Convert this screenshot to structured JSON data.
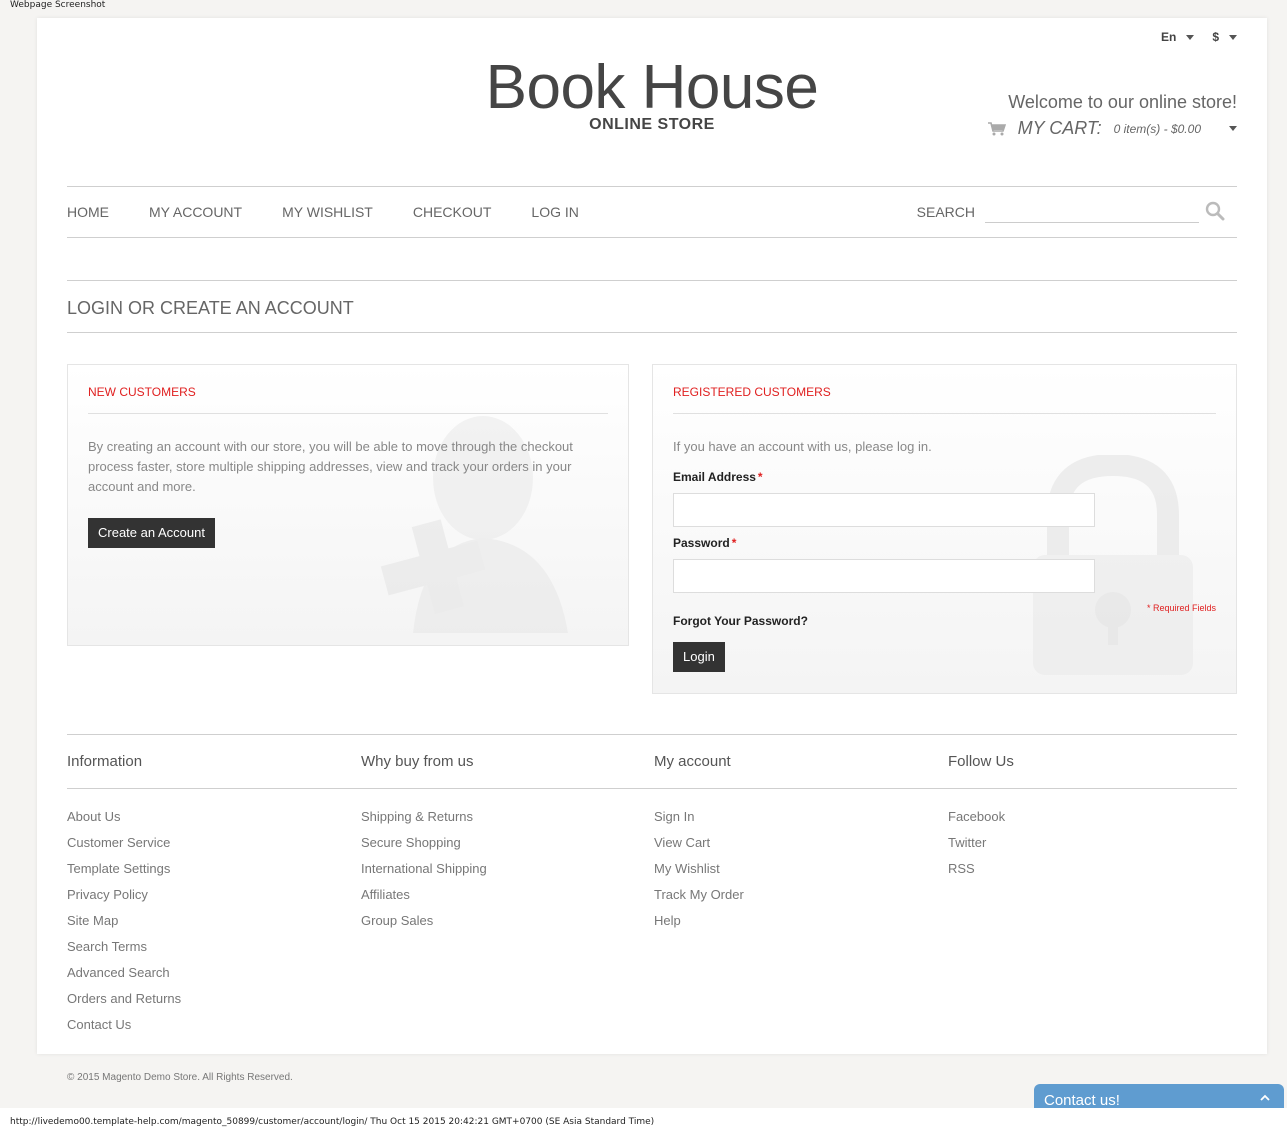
{
  "capture_label": "Webpage Screenshot",
  "header": {
    "language": "En",
    "currency": "$",
    "logo_title": "Book House",
    "logo_subtitle": "ONLINE STORE",
    "welcome": "Welcome to our online store!",
    "cart_label": "MY CART:",
    "cart_summary": "0 item(s) - $0.00"
  },
  "nav": {
    "items": [
      {
        "label": "HOME"
      },
      {
        "label": "MY ACCOUNT"
      },
      {
        "label": "MY WISHLIST"
      },
      {
        "label": "CHECKOUT"
      },
      {
        "label": "LOG IN"
      }
    ],
    "search_label": "SEARCH",
    "search_value": ""
  },
  "page_title": "LOGIN OR CREATE AN ACCOUNT",
  "new_customers": {
    "heading": "NEW CUSTOMERS",
    "text": "By creating an account with our store, you will be able to move through the checkout process faster, store multiple shipping addresses, view and track your orders in your account and more.",
    "button": "Create an Account"
  },
  "registered": {
    "heading": "REGISTERED CUSTOMERS",
    "text": "If you have an account with us, please log in.",
    "email_label": "Email Address",
    "email_value": "",
    "password_label": "Password",
    "password_value": "",
    "required_mark": "*",
    "required_note": "* Required Fields",
    "forgot": "Forgot Your Password?",
    "login_button": "Login"
  },
  "footer": {
    "columns": [
      {
        "title": "Information",
        "links": [
          "About Us",
          "Customer Service",
          "Template Settings",
          "Privacy Policy",
          "Site Map",
          "Search Terms",
          "Advanced Search",
          "Orders and Returns",
          "Contact Us"
        ]
      },
      {
        "title": "Why buy from us",
        "links": [
          "Shipping & Returns",
          "Secure Shopping",
          "International Shipping",
          "Affiliates",
          "Group Sales"
        ]
      },
      {
        "title": "My account",
        "links": [
          "Sign In",
          "View Cart",
          "My Wishlist",
          "Track My Order",
          "Help"
        ]
      },
      {
        "title": "Follow Us",
        "links": [
          "Facebook",
          "Twitter",
          "RSS"
        ]
      }
    ],
    "copyright": "© 2015 Magento Demo Store. All Rights Reserved."
  },
  "contact_tab": "Contact us!",
  "status_bar": "http://livedemo00.template-help.com/magento_50899/customer/account/login/ Thu Oct 15 2015 20:42:21 GMT+0700 (SE Asia Standard Time)"
}
